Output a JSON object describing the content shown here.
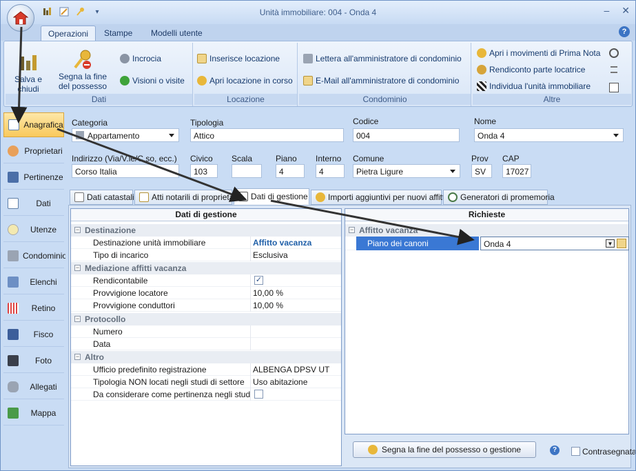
{
  "window": {
    "title": "Unità immobiliare: 004 - Onda 4"
  },
  "ribbon_tabs": [
    "Operazioni",
    "Stampe",
    "Modelli utente"
  ],
  "ribbon": {
    "dati": {
      "label": "Dati",
      "salva": "Salva e\nchiudi",
      "segna": "Segna la fine\ndel possesso",
      "incrocia": "Incrocia",
      "visioni": "Visioni o visite"
    },
    "locazione": {
      "label": "Locazione",
      "inserisce": "Inserisce locazione",
      "apri": "Apri locazione in corso"
    },
    "condominio": {
      "label": "Condominio",
      "lettera": "Lettera all'amministratore di condominio",
      "email": "E-Mail all'amministratore di condominio"
    },
    "altre": {
      "label": "Altre",
      "movimenti": "Apri i movimenti di Prima Nota",
      "rendiconto": "Rendiconto parte locatrice",
      "individua": "Individua l'unità immobiliare"
    }
  },
  "sidebar": [
    "Anagrafica",
    "Proprietari",
    "Pertinenze",
    "Dati",
    "Utenze",
    "Condominio",
    "Elenchi",
    "Retino",
    "Fisco",
    "Foto",
    "Allegati",
    "Mappa"
  ],
  "form": {
    "categoria": {
      "label": "Categoria",
      "value": "Appartamento"
    },
    "tipologia": {
      "label": "Tipologia",
      "value": "Attico"
    },
    "codice": {
      "label": "Codice",
      "value": "004"
    },
    "nome": {
      "label": "Nome",
      "value": "Onda 4"
    },
    "indirizzo": {
      "label": "Indirizzo (Via/V.le/C.so, ecc.)",
      "value": "Corso Italia"
    },
    "civico": {
      "label": "Civico",
      "value": "103"
    },
    "scala": {
      "label": "Scala",
      "value": ""
    },
    "piano": {
      "label": "Piano",
      "value": "4"
    },
    "interno": {
      "label": "Interno",
      "value": "4"
    },
    "comune": {
      "label": "Comune",
      "value": "Pietra Ligure"
    },
    "prov": {
      "label": "Prov",
      "value": "SV"
    },
    "cap": {
      "label": "CAP",
      "value": "17027"
    }
  },
  "subtabs": [
    "Dati catastali",
    "Atti notarili di proprietà",
    "Dati di gestione",
    "Importi aggiuntivi per nuovi affitti",
    "Generatori di promemoria"
  ],
  "left_panel": {
    "header": "Dati di gestione",
    "cat1": "Destinazione",
    "destinazione_name": "Destinazione unità immobiliare",
    "destinazione_val": "Affitto vacanza",
    "tipo_name": "Tipo di incarico",
    "tipo_val": "Esclusiva",
    "cat2": "Mediazione affitti vacanza",
    "rendicontabile": "Rendicontabile",
    "prov_locatore": "Provvigione locatore",
    "prov_locatore_val": "10,00 %",
    "prov_conduttori": "Provvigione conduttori",
    "prov_conduttori_val": "10,00 %",
    "cat3": "Protocollo",
    "numero": "Numero",
    "data": "Data",
    "cat4": "Altro",
    "ufficio": "Ufficio predefinito registrazione",
    "ufficio_val": "ALBENGA DPSV UT",
    "tipologia_non": "Tipologia NON locati negli studi di settore",
    "tipologia_non_val": "Uso abitazione",
    "pertinenza": "Da considerare come pertinenza negli studi di settore"
  },
  "right_panel": {
    "header": "Richieste",
    "cat": "Affitto vacanza",
    "piano_canoni": "Piano dei canoni",
    "piano_canoni_val": "Onda 4"
  },
  "bottom": {
    "segna_btn": "Segna la fine del possesso o gestione",
    "contrasegnata": "Contrasegnata"
  }
}
